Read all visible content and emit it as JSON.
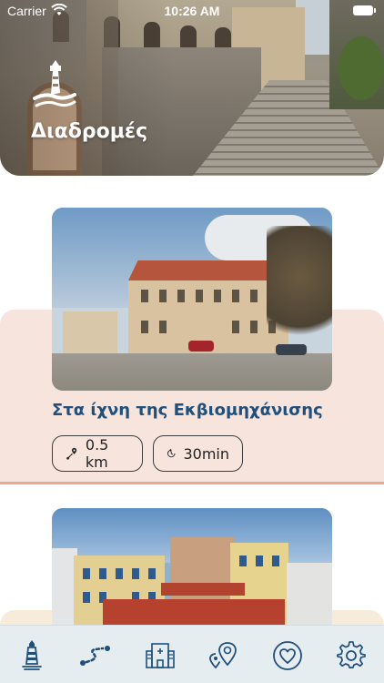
{
  "status_bar": {
    "carrier": "Carrier",
    "time": "10:26 AM"
  },
  "header": {
    "title": "Διαδρομές"
  },
  "routes": [
    {
      "title": "Στα ίχνη της Εκβιομηχάνισης",
      "distance": "0.5 km",
      "duration": "30min"
    }
  ],
  "tabs": [
    {
      "name": "home",
      "icon": "lighthouse-icon",
      "active": false
    },
    {
      "name": "routes",
      "icon": "route-icon",
      "active": true
    },
    {
      "name": "hotels",
      "icon": "hotel-icon",
      "active": false
    },
    {
      "name": "places",
      "icon": "map-pins-icon",
      "active": false
    },
    {
      "name": "favorites",
      "icon": "heart-icon",
      "active": false
    },
    {
      "name": "settings",
      "icon": "gear-icon",
      "active": false
    }
  ],
  "colors": {
    "title_blue": "#1f4f7a",
    "tab_icon": "#1f4f7a",
    "band_pink": "#f6e4dd",
    "band_accent": "#e9a88f",
    "tab_bar_bg": "#e6edf1"
  }
}
